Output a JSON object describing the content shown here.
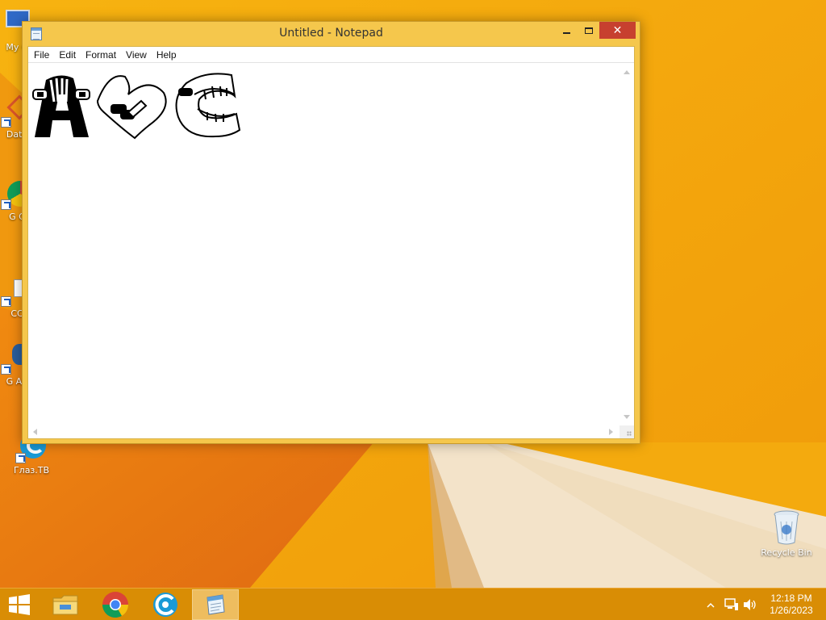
{
  "desktop": {
    "icons": [
      {
        "label": "My C"
      },
      {
        "label": "Data"
      },
      {
        "label": "G C"
      },
      {
        "label": "CC"
      },
      {
        "label": "G Ан"
      },
      {
        "label": "Глаз.ТВ"
      },
      {
        "label": "Recycle Bin"
      }
    ]
  },
  "window": {
    "title": "Untitled - Notepad",
    "close_glyph": "✕",
    "menu": [
      "File",
      "Edit",
      "Format",
      "View",
      "Help"
    ],
    "content_drawing": [
      "letter-a-character",
      "letter-b-character",
      "letter-c-character"
    ]
  },
  "taskbar": {
    "apps": [
      "start-button",
      "file-explorer-icon",
      "chrome-icon",
      "eye-tv-icon",
      "notepad-icon"
    ],
    "tray": [
      "show-hidden-icons-arrow",
      "network-icon",
      "volume-icon"
    ],
    "clock": {
      "time": "12:18 PM",
      "date": "1/26/2023"
    }
  },
  "colors": {
    "wallpaper": "#f4a90c",
    "titlebar": "#f5c74c",
    "close_button": "#c7402f",
    "taskbar": "#d98d05"
  }
}
